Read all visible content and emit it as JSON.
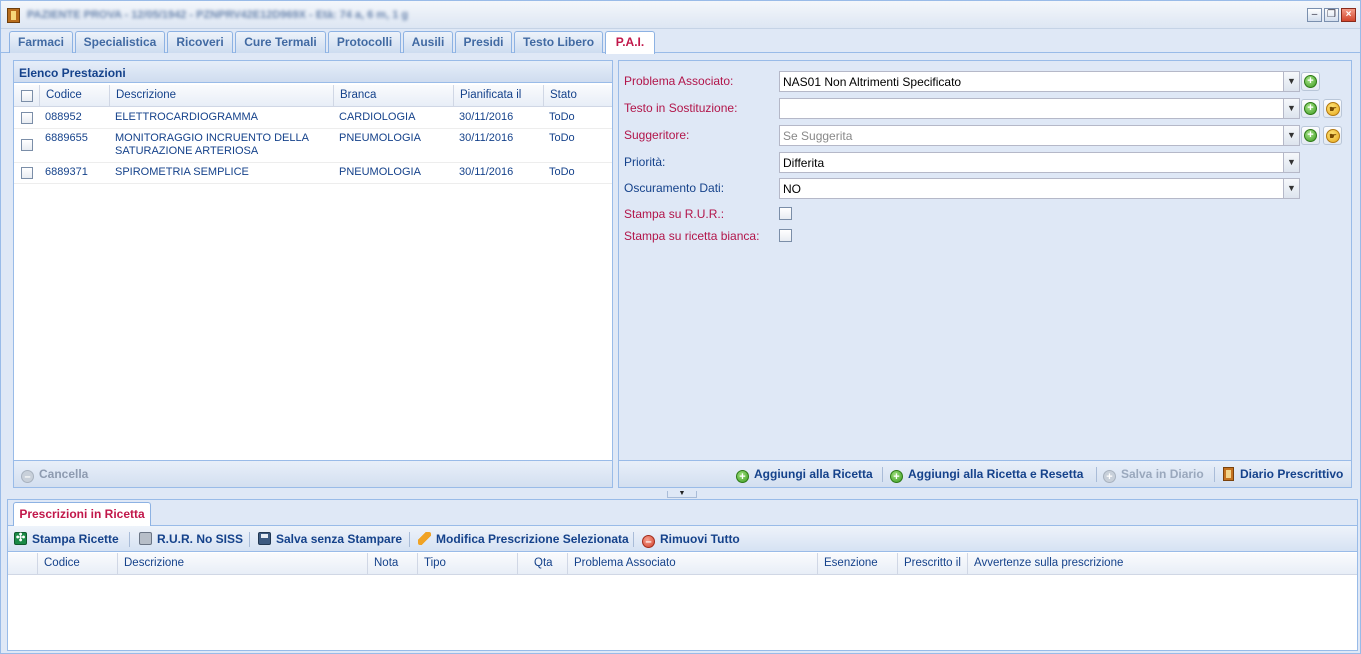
{
  "window": {
    "title": "PAZIENTE PROVA - 12/05/1942 - PZNPRV42E12D969X - Età: 74 a, 6 m, 1 g"
  },
  "tabs": [
    "Farmaci",
    "Specialistica",
    "Ricoveri",
    "Cure Termali",
    "Protocolli",
    "Ausili",
    "Presidi",
    "Testo Libero",
    "P.A.I."
  ],
  "active_tab": "P.A.I.",
  "prestazioni": {
    "title": "Elenco Prestazioni",
    "columns": [
      "Codice",
      "Descrizione",
      "Branca",
      "Pianificata il",
      "Stato"
    ],
    "rows": [
      {
        "codice": "088952",
        "descrizione": "ELETTROCARDIOGRAMMA",
        "branca": "CARDIOLOGIA",
        "pianificata": "30/11/2016",
        "stato": "ToDo"
      },
      {
        "codice": "6889655",
        "descrizione": "MONITORAGGIO INCRUENTO DELLA SATURAZIONE ARTERIOSA",
        "branca": "PNEUMOLOGIA",
        "pianificata": "30/11/2016",
        "stato": "ToDo"
      },
      {
        "codice": "6889371",
        "descrizione": "SPIROMETRIA SEMPLICE",
        "branca": "PNEUMOLOGIA",
        "pianificata": "30/11/2016",
        "stato": "ToDo"
      }
    ],
    "cancel_label": "Cancella"
  },
  "form": {
    "problema_label": "Problema Associato:",
    "problema_value": "NAS01 Non Altrimenti Specificato",
    "testo_label": "Testo in Sostituzione:",
    "testo_value": "",
    "suggeritore_label": "Suggeritore:",
    "suggeritore_placeholder": "Se Suggerita",
    "priorita_label": "Priorità:",
    "priorita_value": "Differita",
    "oscuramento_label": "Oscuramento Dati:",
    "oscuramento_value": "NO",
    "rur_label": "Stampa su R.U.R.:",
    "bianca_label": "Stampa su ricetta bianca:"
  },
  "form_footer": {
    "aggiungi": "Aggiungi alla Ricetta",
    "aggiungi_resetta": "Aggiungi alla Ricetta e Resetta",
    "salva_diario": "Salva in Diario",
    "diario": "Diario Prescrittivo"
  },
  "ricetta": {
    "tab_label": "Prescrizioni in Ricetta",
    "toolbar": {
      "stampa": "Stampa Ricette",
      "rur": "R.U.R. No SISS",
      "salva": "Salva senza Stampare",
      "modifica": "Modifica Prescrizione Selezionata",
      "rimuovi": "Rimuovi Tutto"
    },
    "columns": [
      "Codice",
      "Descrizione",
      "Nota",
      "Tipo",
      "Qta",
      "Problema Associato",
      "Esenzione",
      "Prescritto il",
      "Avvertenze sulla prescrizione"
    ]
  }
}
